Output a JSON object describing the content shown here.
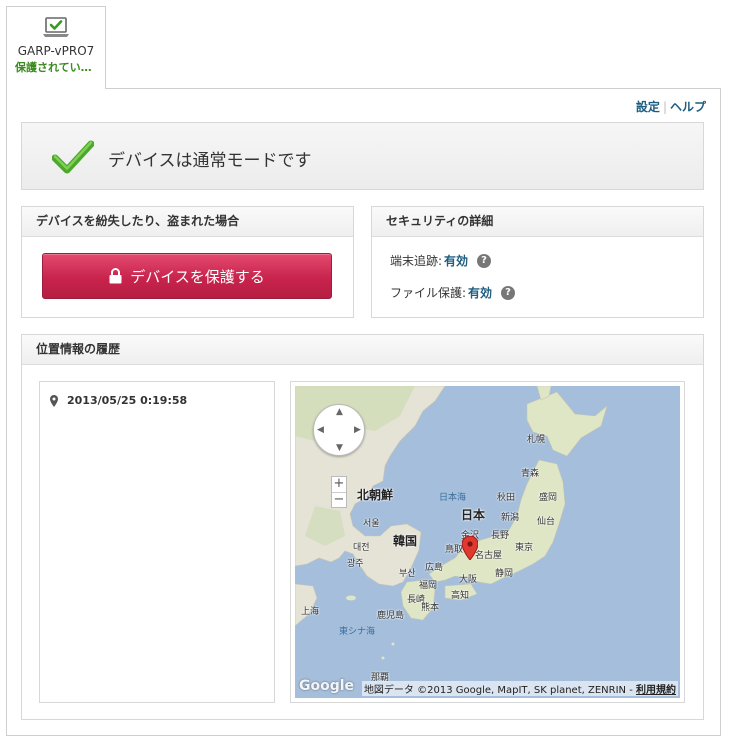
{
  "device": {
    "name": "GARP-vPRO7",
    "status": "保護されてい…"
  },
  "top_links": {
    "settings": "設定",
    "help": "ヘルプ"
  },
  "status_banner": {
    "message": "デバイスは通常モードです"
  },
  "lost_panel": {
    "title": "デバイスを紛失したり、盗まれた場合",
    "protect_button": "デバイスを保護する"
  },
  "security_panel": {
    "title": "セキュリティの詳細",
    "tracking_label": "端末追跡:",
    "tracking_value": "有効",
    "file_protection_label": "ファイル保護:",
    "file_protection_value": "有効"
  },
  "history_panel": {
    "title": "位置情報の履歴",
    "entries": [
      {
        "timestamp": "2013/05/25 0:19:58"
      }
    ]
  },
  "map": {
    "labels": {
      "sapporo": "札幌",
      "aomori": "青森",
      "akita": "秋田",
      "morioka": "盛岡",
      "sea_of_japan": "日本海",
      "north_korea": "北朝鮮",
      "japan": "日本",
      "niigata": "新潟",
      "sendai": "仙台",
      "seoul": "서울",
      "nagano": "長野",
      "kanazawa": "金沢",
      "tokyo": "東京",
      "south_korea": "韓国",
      "daejeon": "대전",
      "tottori": "鳥取",
      "nagoya": "名古屋",
      "gwangju": "광주",
      "busan": "부산",
      "hiroshima": "広島",
      "fukuoka": "福岡",
      "osaka": "大阪",
      "shizuoka": "静岡",
      "nagasaki": "長崎",
      "kumamoto": "熊本",
      "kochi": "高知",
      "shanghai": "上海",
      "kagoshima": "鹿児島",
      "east_china_sea": "東シナ海",
      "naha": "那覇"
    },
    "logo": "Google",
    "copyright": "地図データ ©2013 Google, MapIT, SK planet, ZENRIN -",
    "terms": "利用規約"
  },
  "colors": {
    "link": "#1f5d80",
    "status_green": "#3a8a1f",
    "protect_button": "#c8244d",
    "sea": "#a4bedb",
    "land": "#e5e3d6"
  }
}
